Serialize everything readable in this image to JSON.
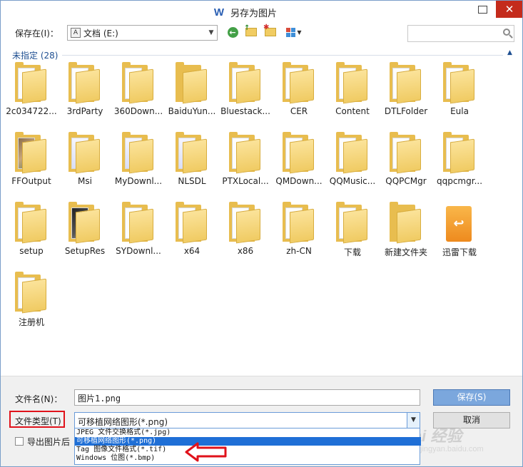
{
  "window": {
    "title": "另存为图片"
  },
  "toolbar": {
    "save_in_label": "保存在(I)：",
    "location": "文档 (E:)",
    "search_placeholder": ""
  },
  "content": {
    "group_header": "未指定 (28)",
    "items": [
      {
        "name": "2c034722...",
        "kind": "doc"
      },
      {
        "name": "3rdParty",
        "kind": "doc"
      },
      {
        "name": "360Down...",
        "kind": "doc"
      },
      {
        "name": "BaiduYun...",
        "kind": "plain"
      },
      {
        "name": "Bluestack...",
        "kind": "doc"
      },
      {
        "name": "CER",
        "kind": "doc"
      },
      {
        "name": "Content",
        "kind": "doc"
      },
      {
        "name": "DTLFolder",
        "kind": "doc"
      },
      {
        "name": "Eula",
        "kind": "doc"
      },
      {
        "name": "FFOutput",
        "kind": "photo"
      },
      {
        "name": "Msi",
        "kind": "blue"
      },
      {
        "name": "MyDownl...",
        "kind": "blue"
      },
      {
        "name": "NLSDL",
        "kind": "blue"
      },
      {
        "name": "PTXLocal...",
        "kind": "doc"
      },
      {
        "name": "QMDown...",
        "kind": "doc"
      },
      {
        "name": "QQMusic...",
        "kind": "doc"
      },
      {
        "name": "QQPCMgr",
        "kind": "doc"
      },
      {
        "name": "qqpcmgr...",
        "kind": "doc"
      },
      {
        "name": "setup",
        "kind": "doc"
      },
      {
        "name": "SetupRes",
        "kind": "dark"
      },
      {
        "name": "SYDownl...",
        "kind": "doc"
      },
      {
        "name": "x64",
        "kind": "doc"
      },
      {
        "name": "x86",
        "kind": "doc"
      },
      {
        "name": "zh-CN",
        "kind": "doc"
      },
      {
        "name": "下载",
        "kind": "doc"
      },
      {
        "name": "新建文件夹",
        "kind": "plain"
      },
      {
        "name": "迅雷下载",
        "kind": "orange"
      },
      {
        "name": "注册机",
        "kind": "doc"
      }
    ]
  },
  "form": {
    "filename_label": "文件名(N)：",
    "filename_value": "图片1.png",
    "filetype_label": "文件类型(T)",
    "filetype_value": "可移植网络图形(*.png)",
    "save_button": "保存(S)",
    "cancel_button": "取消",
    "checkbox_label": "导出图片后",
    "filetype_options": [
      "JPEG 文件交换格式(*.jpg)",
      "可移植网络图形(*.png)",
      "Tag 图像文件格式(*.tif)",
      "Windows 位图(*.bmp)"
    ],
    "selected_option_index": 1
  },
  "watermark": {
    "brand": "Bai 经验",
    "url": "jingyan.baidu.com"
  },
  "colors": {
    "accent": "#1f6fd6",
    "highlight_border": "#e0121b",
    "folder": "#f0cb63"
  }
}
